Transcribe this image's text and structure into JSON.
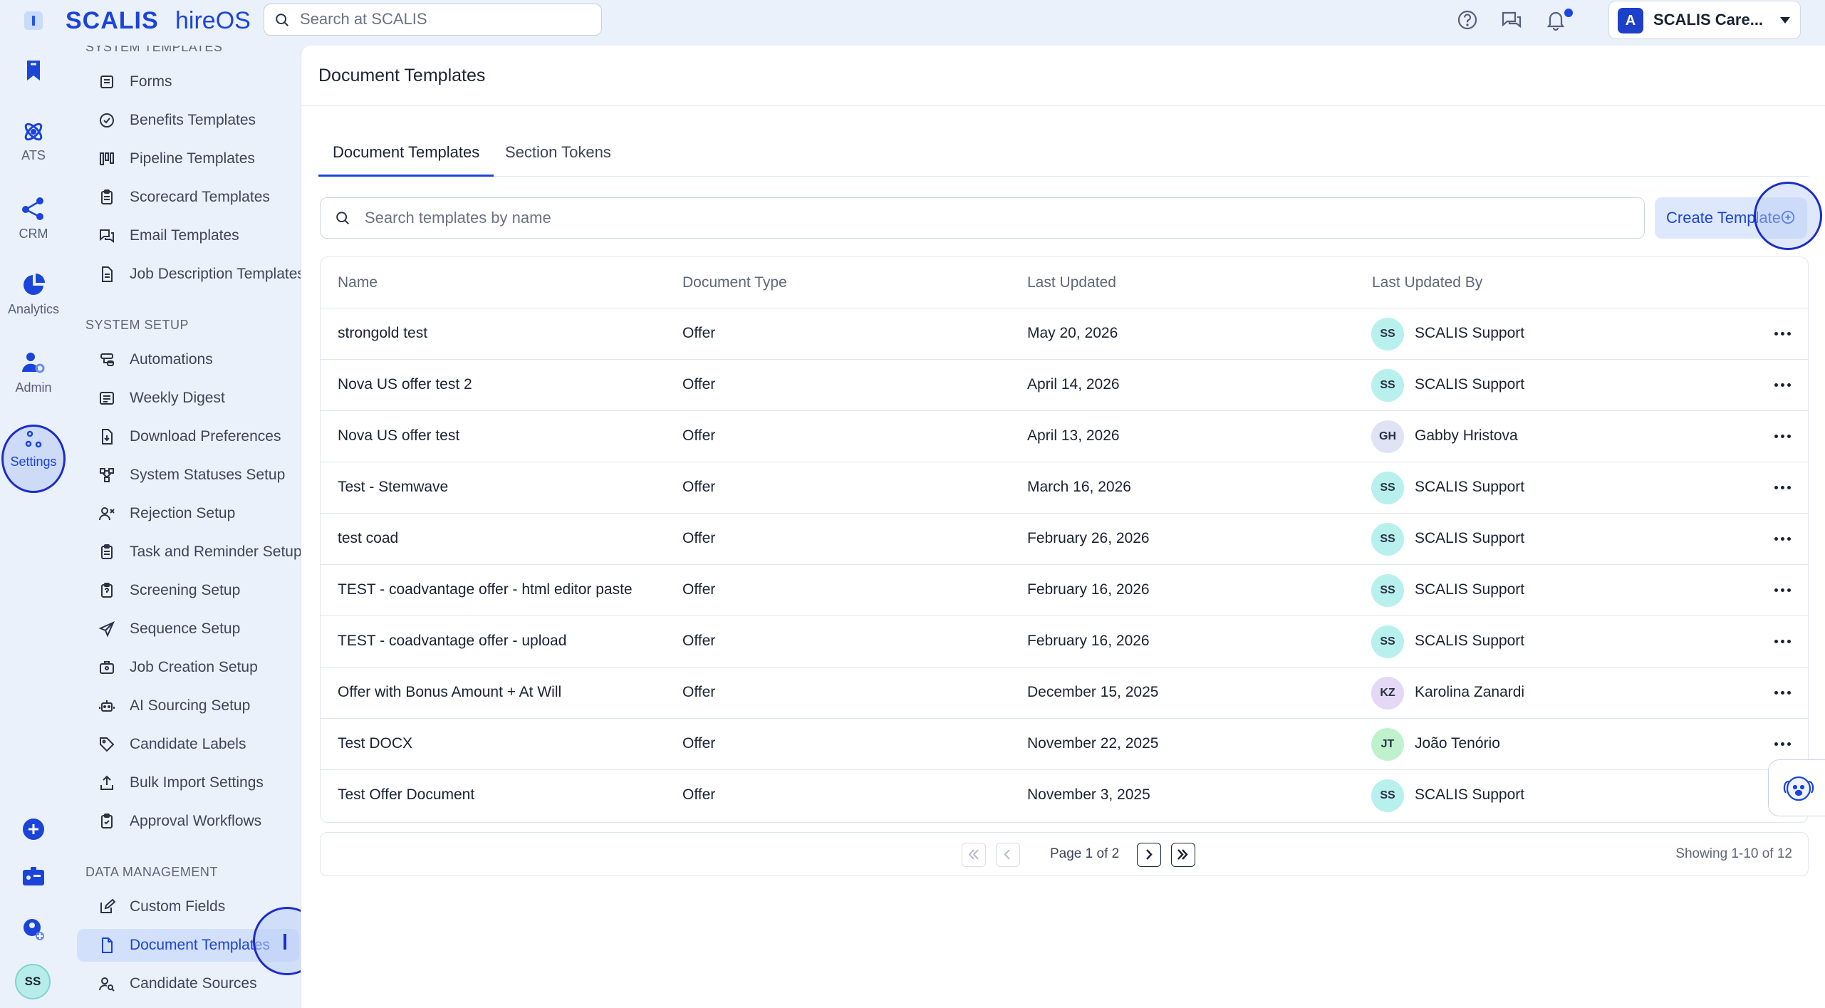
{
  "topbar": {
    "brand": "SCALIS",
    "brand_sub": "hireOS",
    "search_placeholder": "Search at SCALIS",
    "company_logo": "A",
    "company_name": "SCALIS Care..."
  },
  "rail": {
    "items": [
      {
        "label": "",
        "icon": "bookmark-icon"
      },
      {
        "label": "ATS",
        "icon": "atom-icon"
      },
      {
        "label": "CRM",
        "icon": "network-icon"
      },
      {
        "label": "Analytics",
        "icon": "pie-chart-icon"
      },
      {
        "label": "Admin",
        "icon": "user-gear-icon"
      },
      {
        "label": "Settings",
        "icon": "settings-nodes-icon"
      }
    ],
    "bottom_icons": [
      "add-circle-icon",
      "id-card-icon",
      "user-add-icon"
    ],
    "avatar_initials": "SS"
  },
  "sidebar": {
    "section_system_templates": "SYSTEM TEMPLATES",
    "section_system_setup": "SYSTEM SETUP",
    "section_data_management": "DATA MANAGEMENT",
    "system_templates": [
      {
        "label": "Forms",
        "icon": "form-icon"
      },
      {
        "label": "Benefits Templates",
        "icon": "badge-check-icon"
      },
      {
        "label": "Pipeline Templates",
        "icon": "pipeline-icon"
      },
      {
        "label": "Scorecard Templates",
        "icon": "clipboard-icon"
      },
      {
        "label": "Email Templates",
        "icon": "chat-bubbles-icon"
      },
      {
        "label": "Job Description Templates",
        "icon": "document-icon"
      }
    ],
    "system_setup": [
      {
        "label": "Automations",
        "icon": "automation-icon"
      },
      {
        "label": "Weekly Digest",
        "icon": "newspaper-icon"
      },
      {
        "label": "Download Preferences",
        "icon": "file-download-icon"
      },
      {
        "label": "System Statuses Setup",
        "icon": "status-flow-icon"
      },
      {
        "label": "Rejection Setup",
        "icon": "user-x-icon"
      },
      {
        "label": "Task and Reminder Setup",
        "icon": "clipboard-list-icon"
      },
      {
        "label": "Screening Setup",
        "icon": "clipboard-question-icon"
      },
      {
        "label": "Sequence Setup",
        "icon": "send-icon"
      },
      {
        "label": "Job Creation Setup",
        "icon": "briefcase-icon"
      },
      {
        "label": "AI Sourcing Setup",
        "icon": "robot-icon"
      },
      {
        "label": "Candidate Labels",
        "icon": "tag-icon"
      },
      {
        "label": "Bulk Import Settings",
        "icon": "upload-icon"
      },
      {
        "label": "Approval Workflows",
        "icon": "clipboard-check-icon"
      }
    ],
    "data_management": [
      {
        "label": "Custom Fields",
        "icon": "edit-box-icon"
      },
      {
        "label": "Document Templates",
        "icon": "document-icon"
      },
      {
        "label": "Candidate Sources",
        "icon": "user-search-icon"
      }
    ]
  },
  "main": {
    "title": "Document Templates",
    "tabs": [
      {
        "label": "Document Templates",
        "active": true
      },
      {
        "label": "Section Tokens",
        "active": false
      }
    ],
    "search_placeholder": "Search templates by name",
    "create_button": "Create Template",
    "columns": [
      "Name",
      "Document Type",
      "Last Updated",
      "Last Updated By"
    ],
    "rows": [
      {
        "name": "strongold test",
        "type": "Offer",
        "updated": "May 20, 2026",
        "initials": "SS",
        "by": "SCALIS Support"
      },
      {
        "name": "Nova US offer test 2",
        "type": "Offer",
        "updated": "April 14, 2026",
        "initials": "SS",
        "by": "SCALIS Support"
      },
      {
        "name": "Nova US offer test",
        "type": "Offer",
        "updated": "April 13, 2026",
        "initials": "GH",
        "by": "Gabby Hristova"
      },
      {
        "name": "Test - Stemwave",
        "type": "Offer",
        "updated": "March 16, 2026",
        "initials": "SS",
        "by": "SCALIS Support"
      },
      {
        "name": "test coad",
        "type": "Offer",
        "updated": "February 26, 2026",
        "initials": "SS",
        "by": "SCALIS Support"
      },
      {
        "name": "TEST - coadvantage offer - html editor paste",
        "type": "Offer",
        "updated": "February 16, 2026",
        "initials": "SS",
        "by": "SCALIS Support"
      },
      {
        "name": "TEST - coadvantage offer - upload",
        "type": "Offer",
        "updated": "February 16, 2026",
        "initials": "SS",
        "by": "SCALIS Support"
      },
      {
        "name": "Offer with Bonus Amount + At Will",
        "type": "Offer",
        "updated": "December 15, 2025",
        "initials": "KZ",
        "by": "Karolina Zanardi"
      },
      {
        "name": "Test DOCX",
        "type": "Offer",
        "updated": "November 22, 2025",
        "initials": "JT",
        "by": "João Tenório"
      },
      {
        "name": "Test Offer Document",
        "type": "Offer",
        "updated": "November 3, 2025",
        "initials": "SS",
        "by": "SCALIS Support"
      }
    ],
    "pagination": {
      "label": "Page 1 of 2",
      "showing": "Showing 1-10 of 12"
    }
  },
  "colors": {
    "accent": "#1b44d8",
    "rail_bg": "#eaf1fb",
    "active_item_bg": "#d3e0fb"
  }
}
